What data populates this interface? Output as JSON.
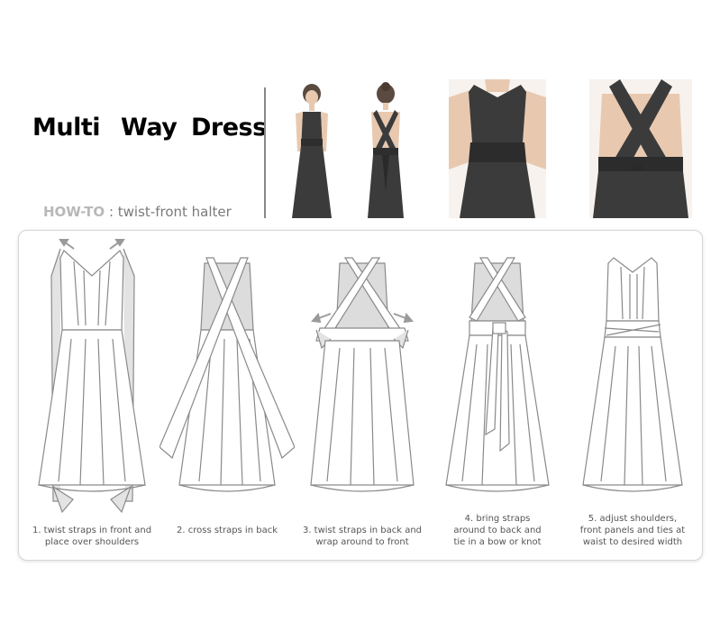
{
  "title": {
    "word1": "Multi",
    "word2": "Way",
    "word3": "Dress"
  },
  "howto": {
    "label": "HOW-TO",
    "separator": " : ",
    "text": "twist-front halter"
  },
  "colors": {
    "dress": "#3b3b3b",
    "line": "#8a8a8a",
    "shade": "#dcdcdc",
    "arrow": "#9a9a9a"
  },
  "steps": [
    {
      "caption": "1. twist straps in front and\nplace over shoulders"
    },
    {
      "caption": "2. cross straps in back"
    },
    {
      "caption": "3. twist straps in back and\nwrap around to front"
    },
    {
      "caption": "4. bring straps\naround to back and\ntie in a bow or knot"
    },
    {
      "caption": "5. adjust shoulders,\nfront panels and ties at\nwaist to desired width"
    }
  ]
}
